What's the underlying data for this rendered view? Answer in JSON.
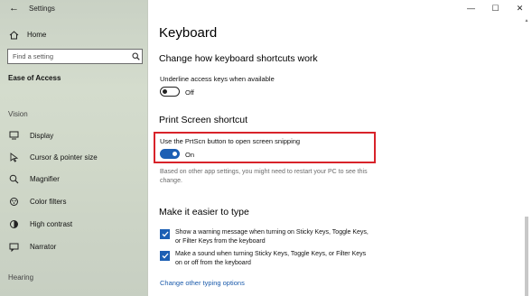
{
  "window": {
    "app_title": "Settings",
    "back_glyph": "←",
    "minimize_glyph": "—",
    "maximize_glyph": "☐",
    "close_glyph": "✕"
  },
  "sidebar": {
    "home_label": "Home",
    "search_placeholder": "Find a setting",
    "section_title": "Ease of Access",
    "groups": {
      "vision": "Vision",
      "hearing": "Hearing"
    },
    "items": [
      {
        "label": "Display",
        "icon": "display-icon"
      },
      {
        "label": "Cursor & pointer size",
        "icon": "cursor-icon"
      },
      {
        "label": "Magnifier",
        "icon": "magnifier-icon"
      },
      {
        "label": "Color filters",
        "icon": "color-filters-icon"
      },
      {
        "label": "High contrast",
        "icon": "high-contrast-icon"
      },
      {
        "label": "Narrator",
        "icon": "narrator-icon"
      }
    ]
  },
  "main": {
    "page_title": "Keyboard",
    "shortcuts": {
      "heading": "Change how keyboard shortcuts work",
      "underline_label": "Underline access keys when available",
      "underline_state": "Off"
    },
    "print_screen": {
      "heading": "Print Screen shortcut",
      "label": "Use the PrtScn button to open screen snipping",
      "state": "On",
      "note": "Based on other app settings, you might need to restart your PC to see this change."
    },
    "typing": {
      "heading": "Make it easier to type",
      "check1": "Show a warning message when turning on Sticky Keys, Toggle Keys, or Filter Keys from the keyboard",
      "check2": "Make a sound when turning Sticky Keys, Toggle Keys, or Filter Keys on or off from the keyboard",
      "link": "Change other typing options"
    }
  },
  "colors": {
    "accent": "#1c5fb4",
    "highlight_border": "#d8232a",
    "link": "#1a5aab"
  }
}
